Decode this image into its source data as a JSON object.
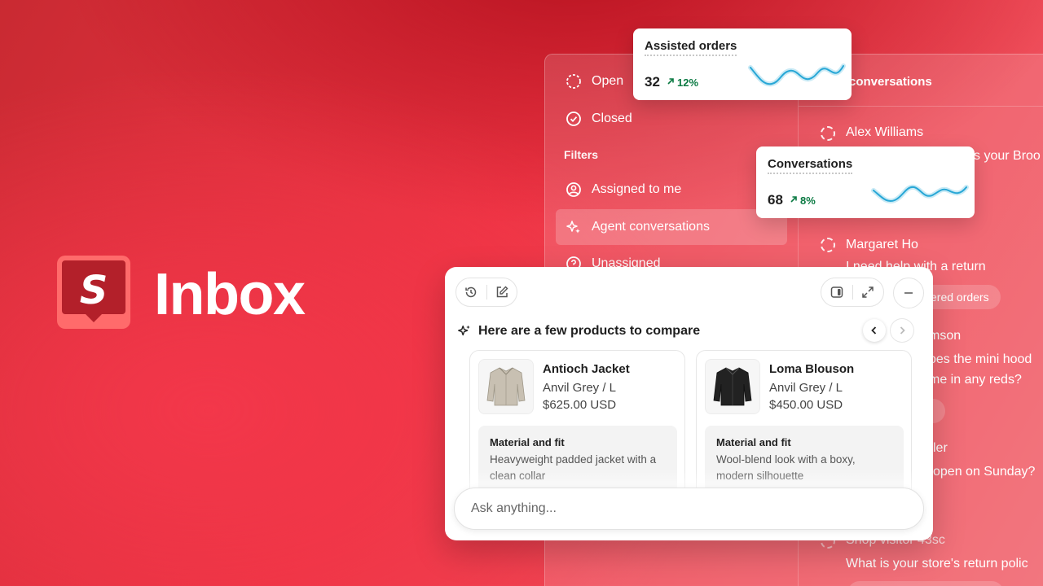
{
  "brand": {
    "name": "Inbox",
    "logo_letter": "S",
    "accent": "#e5323f"
  },
  "sidebar": {
    "items": [
      {
        "label": "Open",
        "icon": "dashed-circle-icon"
      },
      {
        "label": "Closed",
        "icon": "check-circle-icon"
      }
    ],
    "filters_label": "Filters",
    "filters": [
      {
        "label": "Assigned to me",
        "icon": "user-circle-icon"
      },
      {
        "label": "Agent conversations",
        "icon": "sparkle-icon",
        "active": true
      },
      {
        "label": "Unassigned",
        "icon": "question-circle-icon"
      }
    ]
  },
  "conversations": {
    "header": "conversations",
    "items": [
      {
        "name": "Alex Williams",
        "message": "s your Broo"
      },
      {
        "name": "Margaret Ho",
        "message": "I need help with a return",
        "tag": "ered orders"
      },
      {
        "name": "mson",
        "message": "oes the mini hood",
        "message2": "me in any reds?"
      },
      {
        "name": "ler",
        "message": "open on Sunday?"
      },
      {
        "name": "Shop visitor 43sc",
        "message": "What is your store's return polic"
      }
    ]
  },
  "stats": [
    {
      "title": "Assisted orders",
      "value": "32",
      "delta": "12%"
    },
    {
      "title": "Conversations",
      "value": "68",
      "delta": "8%"
    }
  ],
  "assistant": {
    "heading": "Here are a few products to compare",
    "products": [
      {
        "name": "Antioch Jacket",
        "variant": "Anvil Grey / L",
        "price": "$625.00 USD",
        "detail_label": "Material and fit",
        "detail_text": "Heavyweight padded jacket with a clean collar",
        "color": "#c8c0b2"
      },
      {
        "name": "Loma Blouson",
        "variant": "Anvil Grey / L",
        "price": "$450.00 USD",
        "detail_label": "Material and fit",
        "detail_text": "Wool-blend look with a boxy, modern silhouette",
        "color": "#222222"
      }
    ],
    "input_placeholder": "Ask anything..."
  }
}
